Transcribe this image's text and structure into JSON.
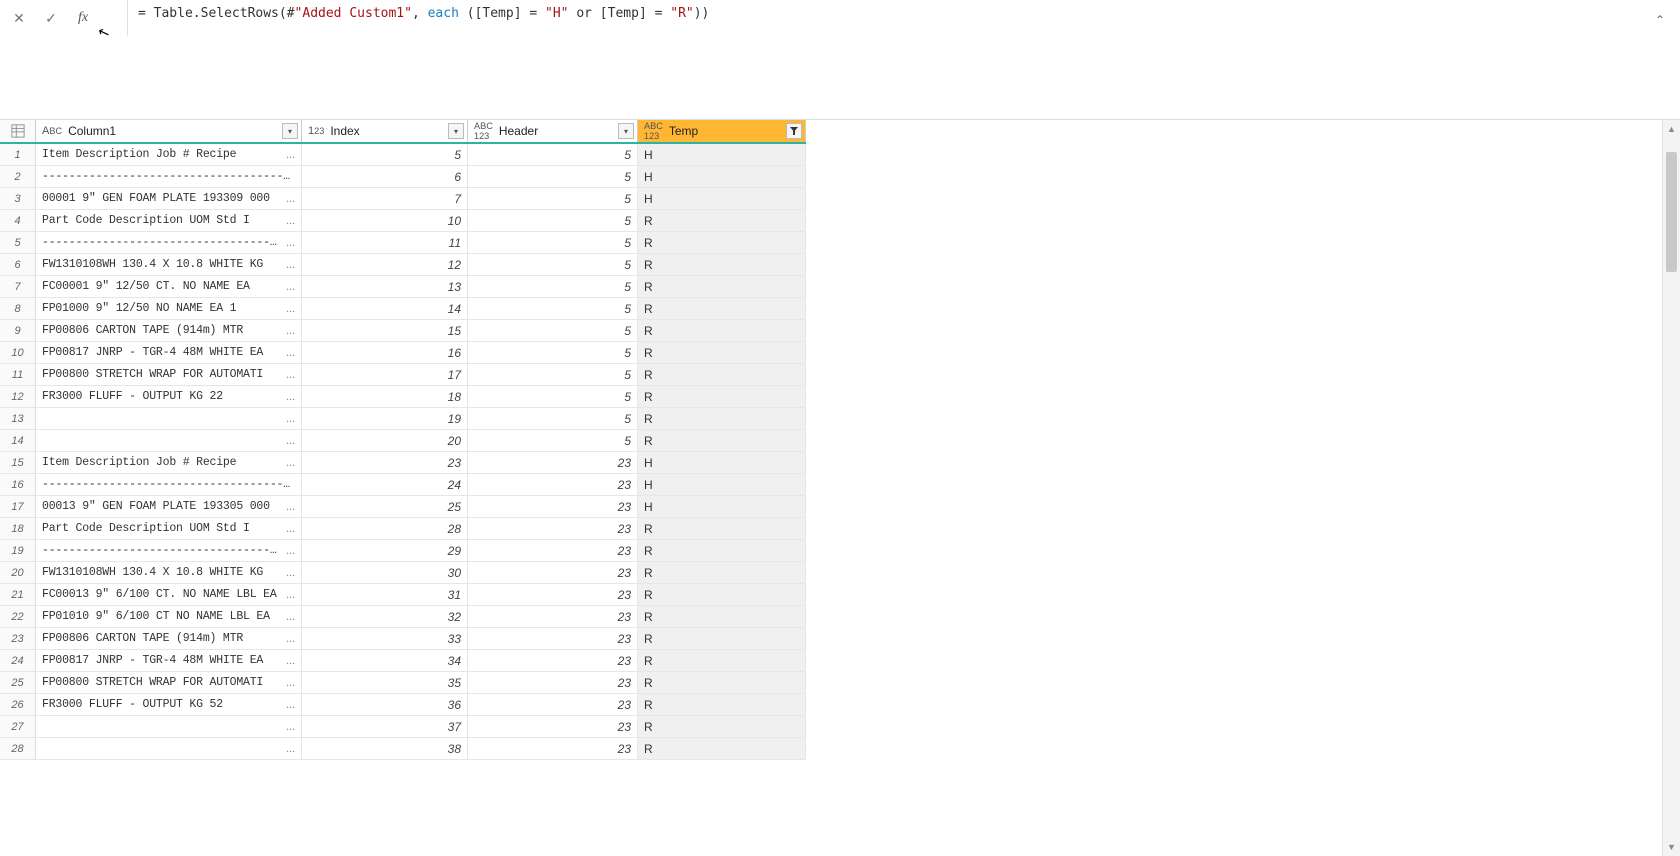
{
  "formula": {
    "prefix": "= Table.SelectRows(#",
    "str1": "\"Added Custom1\"",
    "mid1": ", ",
    "kw": "each",
    "mid2": " ([Temp] = ",
    "str2": "\"H\"",
    "mid3": " or [Temp] = ",
    "str3": "\"R\"",
    "suffix": "))"
  },
  "columns": {
    "c1": {
      "label": "Column1",
      "type": "ABC"
    },
    "idx": {
      "label": "Index",
      "type": "123"
    },
    "hdr": {
      "label": "Header",
      "type": "ABC123"
    },
    "tmp": {
      "label": "Temp",
      "type": "ABC123"
    }
  },
  "rows": [
    {
      "n": "1",
      "c1": "Item      Description              Job #  Recipe",
      "t": "...",
      "idx": "5",
      "hdr": "5",
      "tmp": "H"
    },
    {
      "n": "2",
      "c1": "   ----------------------------------------------------",
      "t": "",
      "idx": "6",
      "hdr": "5",
      "tmp": "H"
    },
    {
      "n": "3",
      "c1": "00001     9\" GEN FOAM PLATE        193309 000",
      "t": "...",
      "idx": "7",
      "hdr": "5",
      "tmp": "H"
    },
    {
      "n": "4",
      "c1": "     Part Code   Description              UOM     Std I",
      "t": "...",
      "idx": "10",
      "hdr": "5",
      "tmp": "R"
    },
    {
      "n": "5",
      "c1": "     ------------------------------------------------",
      "t": "...",
      "idx": "11",
      "hdr": "5",
      "tmp": "R"
    },
    {
      "n": "6",
      "c1": "     FW1310108WH  130.4 X 10.8        WHITE KG ",
      "t": "...",
      "idx": "12",
      "hdr": "5",
      "tmp": "R"
    },
    {
      "n": "7",
      "c1": "     FC00001     9\" 12/50 CT. NO NAME   EA   ",
      "t": "...",
      "idx": "13",
      "hdr": "5",
      "tmp": "R"
    },
    {
      "n": "8",
      "c1": "     FP01000     9\" 12/50 NO NAME       EA     1",
      "t": "...",
      "idx": "14",
      "hdr": "5",
      "tmp": "R"
    },
    {
      "n": "9",
      "c1": "     FP00806     CARTON TAPE (914m)     MTR  ",
      "t": "...",
      "idx": "15",
      "hdr": "5",
      "tmp": "R"
    },
    {
      "n": "10",
      "c1": "     FP00817     JNRP - TGR-4 48M WHITE   EA   ",
      "t": "...",
      "idx": "16",
      "hdr": "5",
      "tmp": "R"
    },
    {
      "n": "11",
      "c1": "     FP00800     STRETCH WRAP FOR AUTOMATI ",
      "t": "...",
      "idx": "17",
      "hdr": "5",
      "tmp": "R"
    },
    {
      "n": "12",
      "c1": "     FR3000      FLUFF - OUTPUT          KG      22",
      "t": "...",
      "idx": "18",
      "hdr": "5",
      "tmp": "R"
    },
    {
      "n": "13",
      "c1": "",
      "t": "...",
      "idx": "19",
      "hdr": "5",
      "tmp": "R"
    },
    {
      "n": "14",
      "c1": "",
      "t": "...",
      "idx": "20",
      "hdr": "5",
      "tmp": "R"
    },
    {
      "n": "15",
      "c1": "Item      Description              Job #  Recipe",
      "t": "...",
      "idx": "23",
      "hdr": "23",
      "tmp": "H"
    },
    {
      "n": "16",
      "c1": "   ----------------------------------------------------",
      "t": "",
      "idx": "24",
      "hdr": "23",
      "tmp": "H"
    },
    {
      "n": "17",
      "c1": "00013     9\" GEN FOAM PLATE        193305 000",
      "t": "...",
      "idx": "25",
      "hdr": "23",
      "tmp": "H"
    },
    {
      "n": "18",
      "c1": "     Part Code   Description              UOM     Std I",
      "t": "...",
      "idx": "28",
      "hdr": "23",
      "tmp": "R"
    },
    {
      "n": "19",
      "c1": "     ------------------------------------------------",
      "t": "...",
      "idx": "29",
      "hdr": "23",
      "tmp": "R"
    },
    {
      "n": "20",
      "c1": "     FW1310108WH  130.4 X 10.8        WHITE KG ",
      "t": "...",
      "idx": "30",
      "hdr": "23",
      "tmp": "R"
    },
    {
      "n": "21",
      "c1": "     FC00013     9\" 6/100 CT. NO NAME LBL  EA  ",
      "t": "...",
      "idx": "31",
      "hdr": "23",
      "tmp": "R"
    },
    {
      "n": "22",
      "c1": "     FP01010     9\" 6/100 CT NO NAME LBL  EA  ",
      "t": "...",
      "idx": "32",
      "hdr": "23",
      "tmp": "R"
    },
    {
      "n": "23",
      "c1": "     FP00806     CARTON TAPE (914m)     MTR  ",
      "t": "...",
      "idx": "33",
      "hdr": "23",
      "tmp": "R"
    },
    {
      "n": "24",
      "c1": "     FP00817     JNRP - TGR-4 48M WHITE   EA   ",
      "t": "...",
      "idx": "34",
      "hdr": "23",
      "tmp": "R"
    },
    {
      "n": "25",
      "c1": "     FP00800     STRETCH WRAP FOR AUTOMATI ",
      "t": "...",
      "idx": "35",
      "hdr": "23",
      "tmp": "R"
    },
    {
      "n": "26",
      "c1": "     FR3000      FLUFF - OUTPUT          KG      52",
      "t": "...",
      "idx": "36",
      "hdr": "23",
      "tmp": "R"
    },
    {
      "n": "27",
      "c1": "",
      "t": "...",
      "idx": "37",
      "hdr": "23",
      "tmp": "R"
    },
    {
      "n": "28",
      "c1": "",
      "t": "...",
      "idx": "38",
      "hdr": "23",
      "tmp": "R"
    }
  ]
}
